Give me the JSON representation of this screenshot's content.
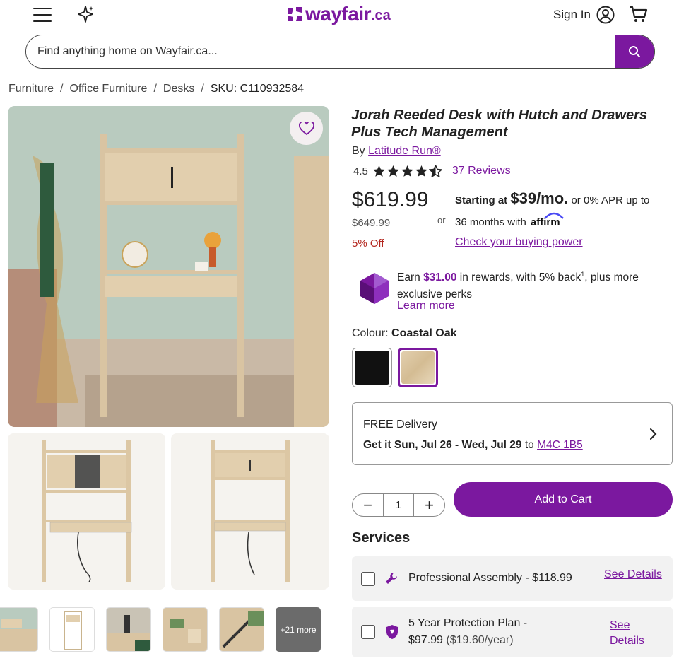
{
  "header": {
    "logo_text": "wayfair",
    "logo_tld": ".ca",
    "sign_in": "Sign In"
  },
  "search": {
    "placeholder": "Find anything home on Wayfair.ca..."
  },
  "breadcrumb": {
    "items": [
      "Furniture",
      "Office Furniture",
      "Desks"
    ],
    "sep": "/",
    "sku": "SKU: C110932584"
  },
  "gallery": {
    "more_label": "+21 more"
  },
  "product": {
    "title": "Jorah Reeded Desk with Hutch and Drawers Plus Tech Management",
    "by": "By",
    "brand": "Latitude Run®",
    "rating": "4.5",
    "rating_value": 4.5,
    "reviews": "37 Reviews",
    "price": "$619.99",
    "was_price": "$649.99",
    "discount": "5% Off",
    "or": "or",
    "financing": {
      "starting": "Starting at",
      "monthly": "$39/mo.",
      "apr": "or 0% APR up to",
      "months": "36 months with",
      "affirm": "affirm",
      "check": "Check your buying power"
    },
    "rewards": {
      "earn": "Earn",
      "amount": "$31.00",
      "rest1": "in rewards, with 5% back",
      "sup": "1",
      "rest2": ", plus more exclusive perks",
      "learn": "Learn more"
    },
    "colour_label": "Colour:",
    "colour_value": "Coastal Oak",
    "swatches": [
      "Black",
      "Coastal Oak"
    ]
  },
  "delivery": {
    "title": "FREE Delivery",
    "date": "Get it Sun, Jul 26 - Wed, Jul 29",
    "to": "to",
    "postal": "M4C 1B5"
  },
  "cart": {
    "qty": "1",
    "minus": "−",
    "plus": "+",
    "add": "Add to Cart"
  },
  "services": {
    "heading": "Services",
    "items": [
      {
        "label": "Professional Assembly - $118.99",
        "link": "See Details"
      },
      {
        "label1": "5 Year Protection Plan -",
        "price": "$97.99",
        "per": "($19.60/year)",
        "link1": "See",
        "link2": "Details"
      }
    ]
  },
  "colors": {
    "brand": "#7b189f"
  }
}
